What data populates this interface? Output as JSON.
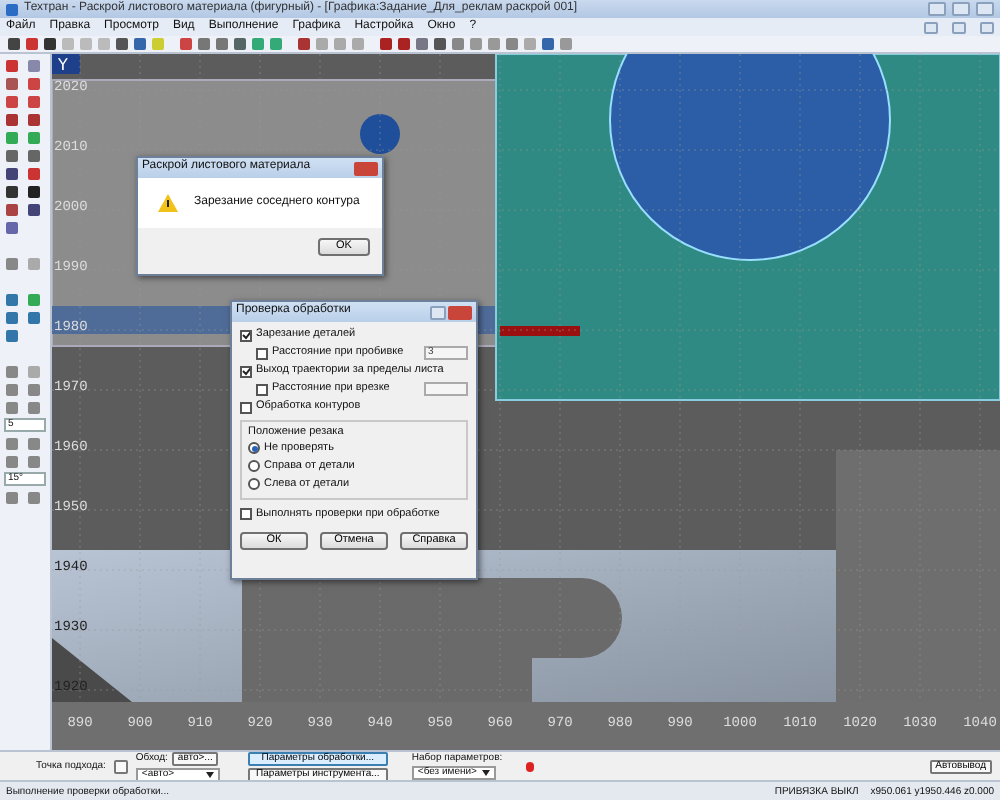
{
  "window": {
    "title": "Техтран - Раскрой листового материала (фигурный) - [Графика:Задание_Для_реклам раскрой 001]"
  },
  "menu": [
    "Файл",
    "Правка",
    "Просмотр",
    "Вид",
    "Выполнение",
    "Графика",
    "Настройка",
    "Окно",
    "?"
  ],
  "left_toolbar": {
    "fields": [
      {
        "value": "5"
      },
      {
        "value": "15°"
      }
    ]
  },
  "canvas": {
    "axis_name": "Y",
    "y_labels": [
      "2020",
      "2010",
      "2000",
      "1990",
      "1980",
      "1970",
      "1960",
      "1950",
      "1940",
      "1930",
      "1920"
    ],
    "x_labels": [
      "890",
      "900",
      "910",
      "920",
      "930",
      "940",
      "950",
      "960",
      "970",
      "980",
      "990",
      "1000",
      "1010",
      "1020",
      "1030",
      "1040"
    ]
  },
  "message_box": {
    "title": "Раскрой листового материала",
    "message": "Зарезание соседнего контура",
    "button": "OK"
  },
  "check_dialog": {
    "title": "Проверка обработки",
    "items": [
      {
        "kind": "checkbox",
        "label": "Зарезание деталей",
        "checked": true
      },
      {
        "kind": "checkbox-field",
        "label": "Расстояние при пробивке",
        "checked": false,
        "value": "3"
      },
      {
        "kind": "checkbox",
        "label": "Выход траектории за пределы листа",
        "checked": true
      },
      {
        "kind": "checkbox-field",
        "label": "Расстояние при врезке",
        "checked": false
      },
      {
        "kind": "checkbox",
        "label": "Обработка контуров",
        "checked": false
      }
    ],
    "group": {
      "title": "Положение резака",
      "options": [
        {
          "label": "Не проверять",
          "selected": true
        },
        {
          "label": "Справа от детали",
          "selected": false
        },
        {
          "label": "Слева от детали",
          "selected": false
        }
      ]
    },
    "final_check": {
      "label": "Выполнять проверки при обработке",
      "checked": false
    },
    "buttons": [
      "ОК",
      "Отмена",
      "Справка"
    ]
  },
  "bottom_panel": {
    "approach_label": "Точка подхода:",
    "bypass_label": "Обход:",
    "bypass_button": "авто>...",
    "bypass_select": "<авто>",
    "params_buttons": [
      "Параметры обработки...",
      "Параметры инструмента..."
    ],
    "set_label": "Набор параметров:",
    "set_select": "<без имени>",
    "auto_button": "Автовывод"
  },
  "status_bar": {
    "message": "Выполнение проверки обработки...",
    "snap": "ПРИВЯЗКА ВЫКЛ",
    "coords": "x950.061 y1950.446 z0.000"
  }
}
